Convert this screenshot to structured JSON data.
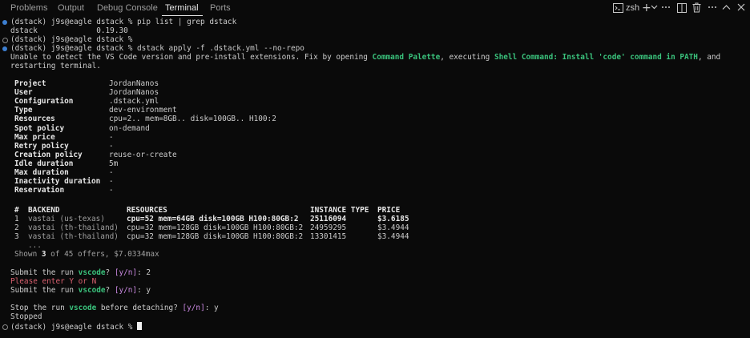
{
  "tabs": [
    "Problems",
    "Output",
    "Debug Console",
    "Terminal",
    "Ports"
  ],
  "toolbar": {
    "shell_name": "zsh"
  },
  "terminal": {
    "prompt_1": "(dstack) j9s@eagle dstack % pip list | grep dstack",
    "pkg_line": "dstack             0.19.30",
    "prompt_2": "(dstack) j9s@eagle dstack %",
    "prompt_3": "(dstack) j9s@eagle dstack % dstack apply -f .dstack.yml --no-repo",
    "warn_a": "Unable to detect the VS Code version and pre-install extensions. Fix by opening ",
    "warn_cmd_palette": "Command Palette",
    "warn_b": ", executing ",
    "warn_shell_cmd": "Shell Command: Install 'code' command in PATH",
    "warn_c": ", and",
    "warn_d": "restarting terminal.",
    "config": [
      {
        "k": "Project",
        "v": "JordanNanos"
      },
      {
        "k": "User",
        "v": "JordanNanos"
      },
      {
        "k": "Configuration",
        "v": ".dstack.yml"
      },
      {
        "k": "Type",
        "v": "dev-environment"
      },
      {
        "k": "Resources",
        "v": "cpu=2.. mem=8GB.. disk=100GB.. H100:2"
      },
      {
        "k": "Spot policy",
        "v": "on-demand"
      },
      {
        "k": "Max price",
        "v": "-"
      },
      {
        "k": "Retry policy",
        "v": "-"
      },
      {
        "k": "Creation policy",
        "v": "reuse-or-create"
      },
      {
        "k": "Idle duration",
        "v": "5m"
      },
      {
        "k": "Max duration",
        "v": "-"
      },
      {
        "k": "Inactivity duration",
        "v": "-"
      },
      {
        "k": "Reservation",
        "v": "-"
      }
    ],
    "offers_header": [
      "#",
      "BACKEND",
      "RESOURCES",
      "INSTANCE TYPE",
      "PRICE"
    ],
    "offers": [
      {
        "n": "1",
        "backend": "vastai (us-texas)",
        "resources": "cpu=52 mem=64GB disk=100GB H100:80GB:2",
        "instance": "25116094",
        "price": "$3.6185"
      },
      {
        "n": "2",
        "backend": "vastai (th-thailand)",
        "resources": "cpu=32 mem=128GB disk=100GB H100:80GB:2",
        "instance": "24959295",
        "price": "$3.4944"
      },
      {
        "n": "3",
        "backend": "vastai (th-thailand)",
        "resources": "cpu=32 mem=128GB disk=100GB H100:80GB:2",
        "instance": "13301415",
        "price": "$3.4944"
      }
    ],
    "ellipsis": "...",
    "shown_a": "Shown ",
    "shown_num": "3",
    "shown_b": " of 45 offers, $7.0334max",
    "submit_prefix": "Submit the run ",
    "run_name": "vscode",
    "submit_suffix_1": "? ",
    "yn": "[y/n]",
    "answer_1": ": 2",
    "enter_yn": "Please enter Y or N",
    "answer_2": ": y",
    "stop_prefix": "Stop the run ",
    "stop_suffix": " before detaching? ",
    "answer_3": ": y",
    "stopped": "Stopped",
    "prompt_final": "(dstack) j9s@eagle dstack % "
  }
}
